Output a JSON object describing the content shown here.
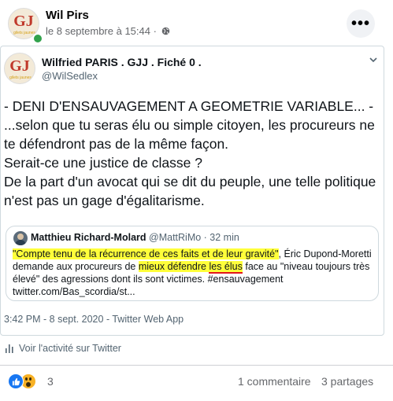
{
  "post": {
    "author": "Wil Pirs",
    "date": "le 8 septembre à 15:44 ·",
    "more_label": "•••"
  },
  "tweet": {
    "name": "Wilfried PARIS . GJJ . Fiché 0 .",
    "handle": "@WilSedlex",
    "text": "- DENI D'ENSAUVAGEMENT A GEOMETRIE VARIABLE... -\n...selon que tu seras élu ou simple citoyen, les procureurs ne te défendront pas de la même façon.\nSerait-ce une justice de classe ?\nDe la part d'un avocat qui se dit du peuple, une telle politique n'est pas un gage d'égalitarisme.",
    "quote": {
      "name": "Matthieu Richard-Molard",
      "handle_time": " @MattRiMo · 32 min",
      "hl1": "\"Compte tenu de la récurrence de ces faits et de leur gravité\"",
      "t1": ", Éric Dupond-Moretti demande aux procureurs de ",
      "hl2": "mieux défendre",
      "t2": " ",
      "hl3": "les élus",
      "t3": " face au \"niveau toujours très élevé\" des agressions dont ils sont victimes. #ensauvagement twitter.com/Bas_scordia/st..."
    },
    "footer": "3:42 PM - 8 sept. 2020 - Twitter Web App",
    "logo_text": "GJ",
    "logo_sub": "gilets jaunes"
  },
  "activity_label": "Voir l'activité sur Twitter",
  "stats": {
    "reaction_count": "3",
    "comments": "1 commentaire",
    "shares": "3 partages"
  },
  "colors": {
    "highlight": "#ffff3a",
    "underline": "#e3161c",
    "facebook_blue": "#1877f2"
  }
}
